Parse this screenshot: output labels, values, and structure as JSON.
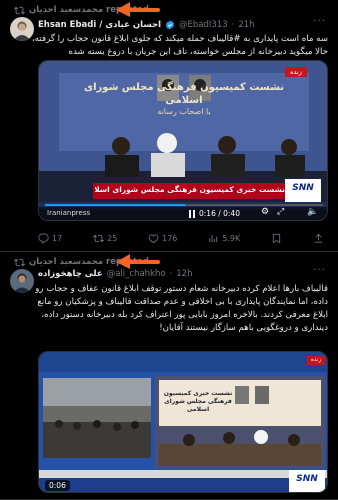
{
  "posts": [
    {
      "repost_label": "محمدسعید احدیان reposted",
      "author_name": "Ehsan Ebadi / احسان عبادی",
      "handle": "@EbadI313",
      "time": "21h",
      "text": "سه ماه است پایداری به #قالیباف حمله میکند که جلوی ابلاغ قانون حجاب را گرفته، حالا میگوید دبیرخانه از مجلس خواسته، ناف این جریان با دروغ بسته شده",
      "video": {
        "banner_text": "نشست خبری کمیسیون فرهنگی مجلس شورای اسلامی",
        "wall_text": "نشست کمیسیون فرهنگی مجلس شورای اسلامی",
        "wall_sub": "با اصحاب رسانه",
        "live_tag": "زنده",
        "channel_logo": "SNN",
        "time_display": "0:16 / 0:40",
        "ticker": "Iranianpress"
      },
      "actions": {
        "replies": "17",
        "reposts": "25",
        "likes": "176",
        "views": "5.9K"
      }
    },
    {
      "repost_label": "محمدسعید احدیان reposted",
      "author_name": "علی چاهخوزاده",
      "handle": "@ali_chahkho",
      "time": "12h",
      "text": "قالیباف بارها اعلام کرده دبیرخانه شعام دستور توقف ابلاغ قانون عفاف و حجاب رو داده، اما نمایندگان پایداری با بی اخلاقی و عدم صداقت قالیباف و پزشکیان رو مانع ابلاغ معرفی کردند. بالاخره امروز بابایی پور اعتراف کرد بله دبیرخانه دستور داده، دینداری و دروغگویی باهم سازگار نیستند آقایان!",
      "video": {
        "wall_text": "نشست خبری کمیسیون فرهنگی مجلس شورای اسلامی",
        "live_tag": "زنده",
        "time_display": "0:06",
        "channel_logo": "SNN"
      }
    }
  ],
  "colors": {
    "background": "#000000",
    "text": "#e7e9ea",
    "muted": "#71767b",
    "annotation_arrow": "#f26522",
    "video_banner_red": "#b3001b"
  }
}
